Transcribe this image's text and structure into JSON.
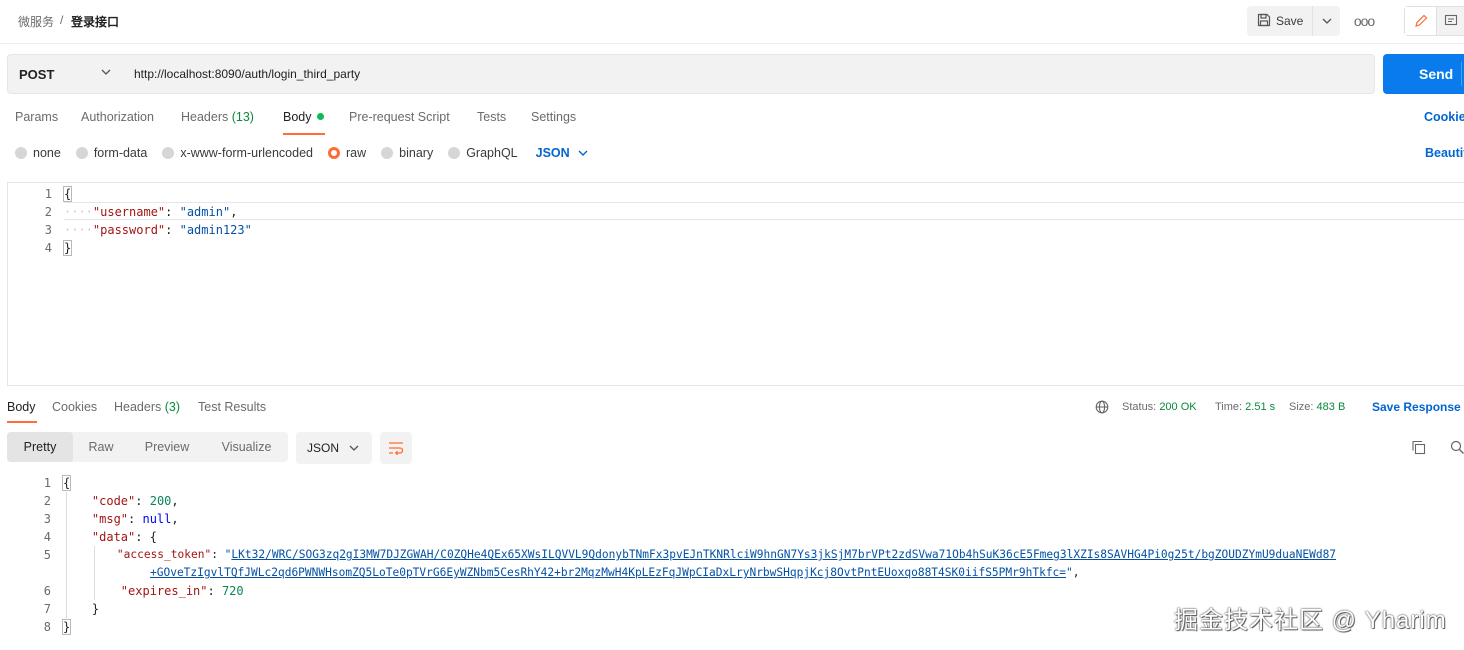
{
  "breadcrumb": {
    "parent": "微服务",
    "separator": "/",
    "title": "登录接口"
  },
  "toolbar": {
    "save_label": "Save",
    "more_label": "ooo"
  },
  "request": {
    "method": "POST",
    "url": "http://localhost:8090/auth/login_third_party",
    "send_label": "Send"
  },
  "request_tabs": {
    "params": "Params",
    "authorization": "Authorization",
    "headers": "Headers",
    "headers_count": "(13)",
    "body": "Body",
    "pre_request": "Pre-request Script",
    "tests": "Tests",
    "settings": "Settings",
    "cookies_link": "Cookie",
    "beautify_link": "Beautif"
  },
  "body_types": {
    "none": "none",
    "form_data": "form-data",
    "urlencoded": "x-www-form-urlencoded",
    "raw": "raw",
    "binary": "binary",
    "graphql": "GraphQL",
    "format": "JSON",
    "selected": "raw"
  },
  "request_body": {
    "line_numbers": [
      "1",
      "2",
      "3",
      "4"
    ],
    "open": "{",
    "close": "}",
    "username_key": "\"username\"",
    "username_value": "\"admin\"",
    "password_key": "\"password\"",
    "password_value": "\"admin123\""
  },
  "response_tabs": {
    "body": "Body",
    "cookies": "Cookies",
    "headers": "Headers",
    "headers_count": "(3)",
    "test_results": "Test Results"
  },
  "response_meta": {
    "status_label": "Status:",
    "status_value": "200 OK",
    "time_label": "Time:",
    "time_value": "2.51 s",
    "size_label": "Size:",
    "size_value": "483 B",
    "save_response": "Save Response"
  },
  "view_tabs": {
    "pretty": "Pretty",
    "raw": "Raw",
    "preview": "Preview",
    "visualize": "Visualize",
    "format": "JSON"
  },
  "response_body": {
    "line_numbers": [
      "1",
      "2",
      "3",
      "4",
      "5",
      "",
      "6",
      "7",
      "8"
    ],
    "code_key": "\"code\"",
    "code_value": "200",
    "msg_key": "\"msg\"",
    "msg_value": "null",
    "data_key": "\"data\"",
    "access_token_key": "\"access_token\"",
    "access_token_part1": "LKt32/WRC/SOG3zq2gI3MW7DJZGWAH/C0ZQHe4QEx65XWsILQVVL9QdonybTNmFx3pvEJnTKNRlciW9hnGN7Ys3jkSjM7brVPt2zdSVwa71Ob4hSuK36cE5Fmeg3lXZIs8SAVHG4Pi0g25t/bgZOUDZYmU9duaNEWd87",
    "access_token_part2": "+GOveTzIgvlTQfJWLc2qd6PWNWHsomZQ5LoTe0pTVrG6EyWZNbm5CesRhY42+br2MqzMwH4KpLEzFqJWpCIaDxLryNrbwSHqpjKcj8OvtPntEUoxqo88T4SK0iifS5PMr9hTkfc=",
    "expires_key": "\"expires_in\"",
    "expires_value": "720"
  },
  "watermark": "掘金技术社区 @ Yharim",
  "colors": {
    "accent": "#ff6c37",
    "send": "#097bed",
    "link": "#0265d2",
    "status_ok": "#0a8a3a"
  }
}
